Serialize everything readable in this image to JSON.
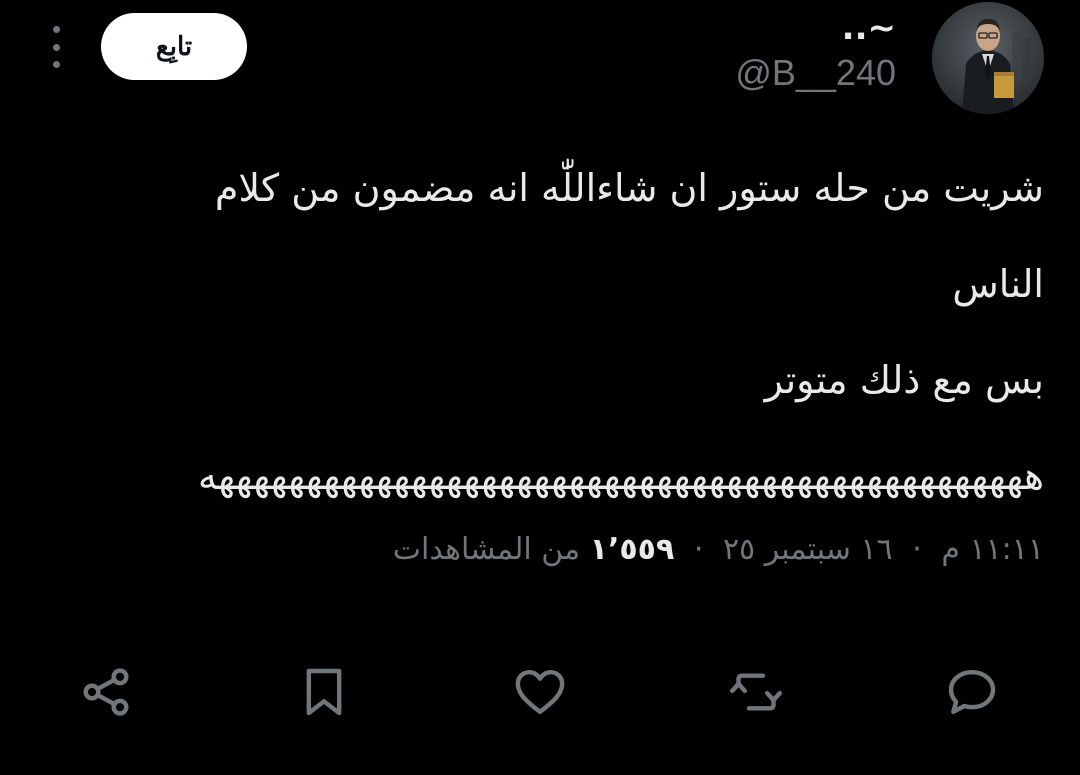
{
  "header": {
    "display_name": "~..",
    "handle": "@B__240",
    "follow_label": "تابِع"
  },
  "tweet": {
    "lines": [
      "شريت من حله ستور ان شاءاللّٰه انه مضمون من كلام",
      "الناس",
      "بس مع ذلك متوتر",
      "هههههههههههههههههههههههههههههههههههههههههههههههه"
    ]
  },
  "meta": {
    "time": "١١:١١ م",
    "date": "١٦ سبتمبر ٢٥",
    "views_count": "١٬٥٥٩",
    "views_label": "من المشاهدات",
    "separator": "·"
  },
  "actions": {
    "icons": [
      "reply-icon",
      "retweet-icon",
      "like-icon",
      "bookmark-icon",
      "share-icon"
    ]
  },
  "colors": {
    "background": "#000000",
    "text_primary": "#e7e9ea",
    "text_secondary": "#71767b",
    "follow_bg": "#ffffff"
  }
}
